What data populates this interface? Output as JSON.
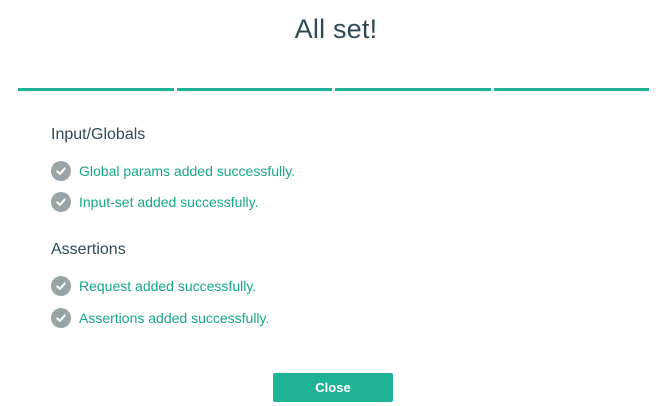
{
  "dialog": {
    "title": "All set!",
    "progress_steps": 4,
    "accent_color": "#1fb396"
  },
  "sections": [
    {
      "title": "Input/Globals",
      "items": [
        {
          "icon": "check-circle-icon",
          "label": "Global params added successfully."
        },
        {
          "icon": "check-circle-icon",
          "label": "Input-set added successfully."
        }
      ]
    },
    {
      "title": "Assertions",
      "items": [
        {
          "icon": "check-circle-icon",
          "label": "Request added successfully."
        },
        {
          "icon": "check-circle-icon",
          "label": "Assertions added successfully."
        }
      ]
    }
  ],
  "footer": {
    "close_label": "Close"
  }
}
